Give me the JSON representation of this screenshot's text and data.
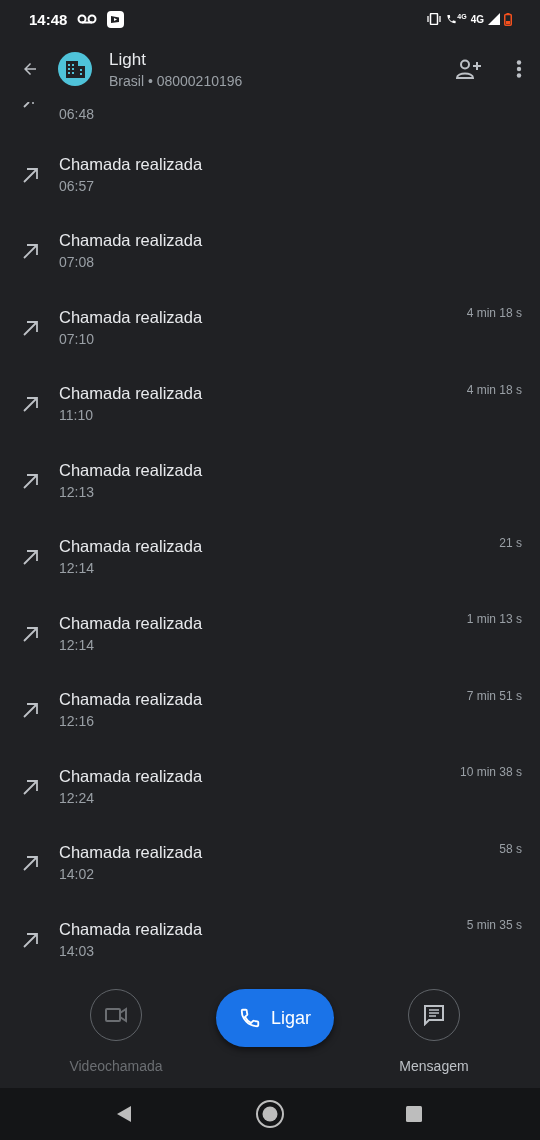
{
  "status_bar": {
    "time": "14:48",
    "network_label_call": "4G",
    "network_label": "4G"
  },
  "header": {
    "name": "Light",
    "subtitle": "Brasil • 08000210196"
  },
  "calls": [
    {
      "kind": "partial",
      "time": "06:48"
    },
    {
      "kind": "outgoing",
      "title": "Chamada realizada",
      "time": "06:57"
    },
    {
      "kind": "outgoing",
      "title": "Chamada realizada",
      "time": "07:08"
    },
    {
      "kind": "outgoing",
      "title": "Chamada realizada",
      "time": "07:10",
      "duration": "4 min 18 s"
    },
    {
      "kind": "outgoing",
      "title": "Chamada realizada",
      "time": "11:10",
      "duration": "4 min 18 s"
    },
    {
      "kind": "outgoing",
      "title": "Chamada realizada",
      "time": "12:13"
    },
    {
      "kind": "outgoing",
      "title": "Chamada realizada",
      "time": "12:14",
      "duration": "21 s"
    },
    {
      "kind": "outgoing",
      "title": "Chamada realizada",
      "time": "12:14",
      "duration": "1 min 13 s"
    },
    {
      "kind": "outgoing",
      "title": "Chamada realizada",
      "time": "12:16",
      "duration": "7 min 51 s"
    },
    {
      "kind": "outgoing",
      "title": "Chamada realizada",
      "time": "12:24",
      "duration": "10 min 38 s"
    },
    {
      "kind": "outgoing",
      "title": "Chamada realizada",
      "time": "14:02",
      "duration": "58 s"
    },
    {
      "kind": "outgoing",
      "title": "Chamada realizada",
      "time": "14:03",
      "duration": "5 min 35 s"
    }
  ],
  "actions": [
    {
      "kind": "video",
      "label": "Videochamada",
      "disabled": true
    },
    {
      "kind": "call",
      "label": "Ligar",
      "disabled": false
    },
    {
      "kind": "message",
      "label": "Mensagem",
      "disabled": false
    }
  ]
}
